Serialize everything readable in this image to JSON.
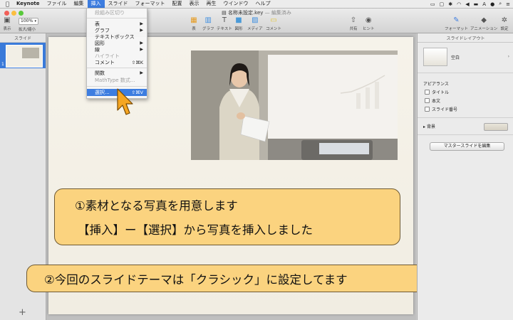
{
  "menubar": {
    "app": "Keynote",
    "items": [
      "ファイル",
      "編集",
      "挿入",
      "スライド",
      "フォーマット",
      "配置",
      "表示",
      "再生",
      "ウインドウ",
      "ヘルプ"
    ],
    "active": "挿入"
  },
  "window": {
    "doc_name": "名称未設定.key",
    "doc_status": "— 編集済み"
  },
  "toolbar": {
    "view_label": "表示",
    "zoom_value": "100%",
    "zoom_label": "拡大/縮小",
    "table_label": "表",
    "chart_label": "グラフ",
    "text_label": "テキスト",
    "shape_label": "図形",
    "media_label": "メディア",
    "comment_label": "コメント",
    "share_label": "共有",
    "tips_label": "ヒント",
    "format_label": "フォーマット",
    "animation_label": "アニメーション",
    "setup_label": "設定"
  },
  "navigator": {
    "header": "スライド",
    "slide_number": "1",
    "add_label": "+"
  },
  "insert_menu": {
    "items": [
      {
        "label": "段組み区切り",
        "disabled": true
      },
      {
        "label": "表",
        "submenu": true
      },
      {
        "label": "グラフ",
        "submenu": true
      },
      {
        "label": "テキストボックス"
      },
      {
        "label": "図形",
        "submenu": true
      },
      {
        "label": "線",
        "submenu": true
      },
      {
        "label": "ハイライト",
        "disabled": true
      },
      {
        "label": "コメント",
        "shortcut": "⇧⌘K"
      },
      {
        "label": "関数",
        "submenu": true
      },
      {
        "label": "MathType 数式...",
        "disabled": true
      },
      {
        "label": "選択...",
        "shortcut": "⇧⌘V",
        "highlighted": true
      }
    ]
  },
  "slide": {
    "callout1_line1": "①素材となる写真を用意します",
    "callout1_line2": "【挿入】ー【選択】から写真を挿入しました",
    "callout2": "②今回のスライドテーマは「クラシック」に設定してます"
  },
  "inspector": {
    "header": "スライドレイアウト",
    "layout_name": "空白",
    "appearance_label": "アピアランス",
    "checkboxes": [
      "タイトル",
      "本文",
      "スライド番号"
    ],
    "background_label": "背景",
    "master_button": "マスタースライドを編集"
  }
}
